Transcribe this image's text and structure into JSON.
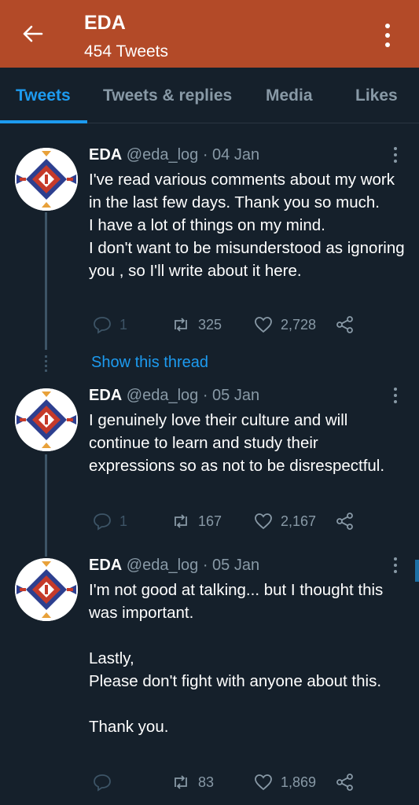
{
  "header": {
    "title": "EDA",
    "subtitle": "454 Tweets"
  },
  "tabs": [
    {
      "label": "Tweets",
      "active": true
    },
    {
      "label": "Tweets & replies",
      "active": false
    },
    {
      "label": "Media",
      "active": false
    },
    {
      "label": "Likes",
      "active": false
    }
  ],
  "show_thread_label": "Show this thread",
  "tweets": [
    {
      "name": "EDA",
      "meta": "@eda_log · 04 Jan",
      "text": "I've read various comments about my work in the last few days.  Thank you so much.\nI have a lot of things on my mind.\nI don't want to be misunderstood as ignoring you , so I'll write about it here.",
      "replies": "1",
      "retweets": "325",
      "likes": "2,728"
    },
    {
      "name": "EDA",
      "meta": "@eda_log · 05 Jan",
      "text": "I genuinely love their culture and will continue to learn and study their expressions so as not to be disrespectful.",
      "replies": "1",
      "retweets": "167",
      "likes": "2,167"
    },
    {
      "name": "EDA",
      "meta": "@eda_log · 05 Jan",
      "text": "I'm not good at talking... but I thought this was important.\n\nLastly,\nPlease don't fight with anyone about this.\n\nThank you.",
      "replies": "",
      "retweets": "83",
      "likes": "1,869"
    }
  ],
  "colors": {
    "header_bg": "#b34a28",
    "background": "#15202b",
    "accent": "#1d9bf0",
    "muted": "#8899a6"
  }
}
